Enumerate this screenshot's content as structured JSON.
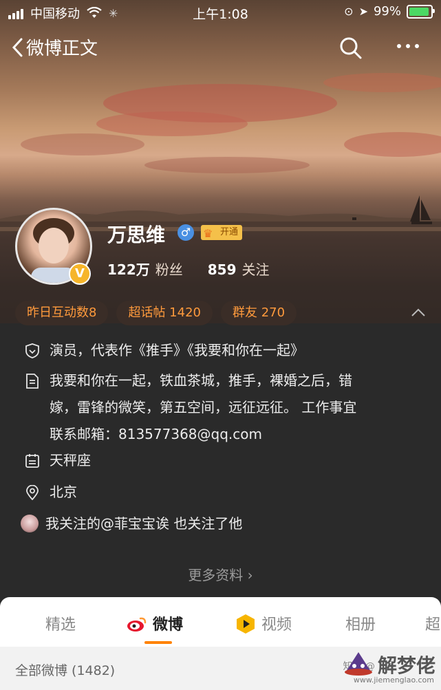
{
  "statusbar": {
    "carrier": "中国移动",
    "time": "上午1:08",
    "battery": "99%"
  },
  "nav": {
    "title": "微博正文"
  },
  "profile": {
    "name": "万思维",
    "gender_symbol": "♂",
    "vip_badge": "开通",
    "verify_badge": "V",
    "fans_count": "122万",
    "fans_label": "粉丝",
    "following_count": "859",
    "following_label": "关注"
  },
  "pills": [
    {
      "label": "昨日互动数8"
    },
    {
      "label": "超话帖 1420"
    },
    {
      "label": "群友 270"
    }
  ],
  "info": {
    "bio": "演员，代表作《推手》《我要和你在一起》",
    "description_line1": "我要和你在一起，铁血茶城，推手，裸婚之后，错",
    "description_line2": "嫁，雷锋的微笑，第五空间，远征远征。  工作事宜",
    "description_line3": "联系邮箱：813577368@qq.com",
    "zodiac": "天秤座",
    "location": "北京",
    "mutual": "我关注的@菲宝宝诶  也关注了他"
  },
  "more_info": "更多资料 ›",
  "tabs": [
    {
      "label": "精选"
    },
    {
      "label": "微博"
    },
    {
      "label": "视频"
    },
    {
      "label": "相册"
    },
    {
      "label": "超"
    }
  ],
  "subbar": {
    "all_weibo": "全部微博 (1482)"
  },
  "watermark": {
    "zhihu": "知乎 @",
    "brand": "解梦佬",
    "url": "www.jiemenglao.com"
  },
  "colors": {
    "accent_orange": "#ff8200",
    "pill_text": "#ff9a3c",
    "battery_green": "#4cd964",
    "verify_gold": "#f6b52a"
  }
}
